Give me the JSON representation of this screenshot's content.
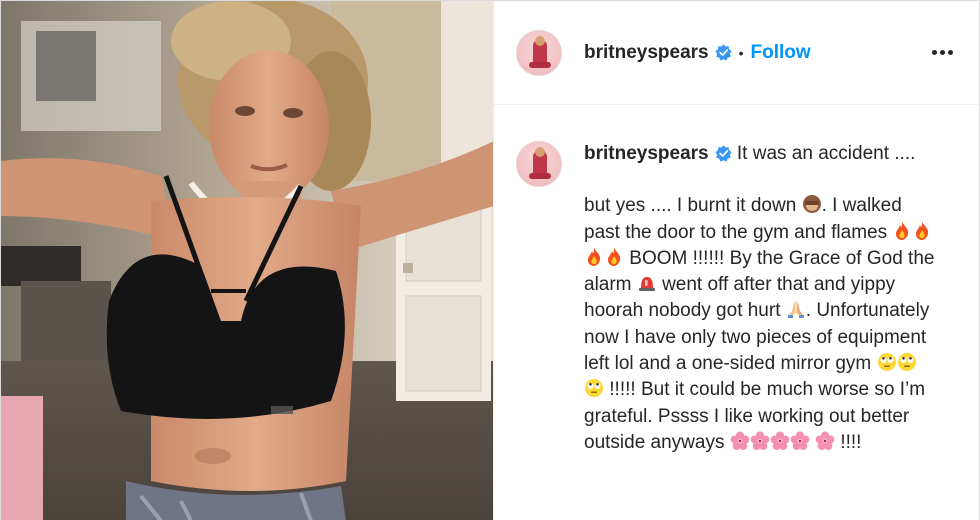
{
  "post": {
    "username": "britneyspears",
    "verified": true,
    "separator": "•",
    "follow_label": "Follow",
    "more_icon": "more-horizontal-icon",
    "caption_first": "It was an accident ....",
    "caption_lines": [
      "but yes .... I burnt it down",
      ". I walked past the door to the gym and flames",
      "BOOM !!!!!! By the Grace of God the alarm",
      "went off after that and yippy hoorah nobody got hurt",
      ". Unfortunately now I have only two pieces of equipment left lol and a one-sided mirror gym",
      "!!!!! But it could be much worse so I’m grateful. Pssss I like working out better outside anyways",
      "!!!!"
    ],
    "emojis": {
      "see_no_evil": "monkey-emoji",
      "fire": "fire-emoji",
      "siren": "siren-emoji",
      "pray": "folded-hands-emoji",
      "rolling_eyes": "rolling-eyes-emoji",
      "blossom": "cherry-blossom-emoji"
    },
    "colors": {
      "link_blue": "#0095f6",
      "verified_blue": "#3897f0",
      "text": "#262626",
      "border": "#efefef"
    }
  }
}
